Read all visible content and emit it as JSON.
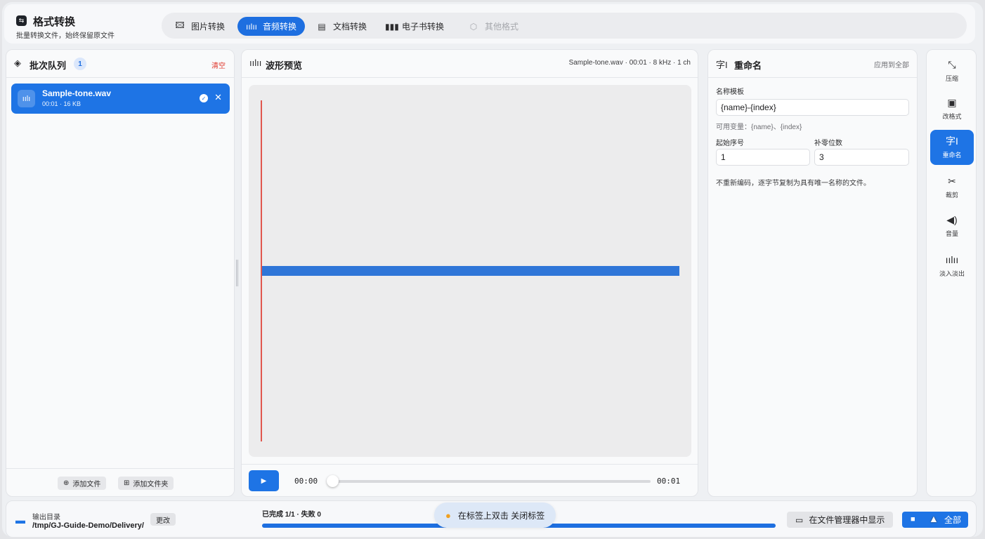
{
  "app": {
    "title": "格式转换",
    "subtitle": "批量转换文件，始终保留原文件",
    "icon": "swap-icon"
  },
  "tabs": [
    {
      "label": "图片转换",
      "icon": "image-icon",
      "active": false
    },
    {
      "label": "音频转换",
      "icon": "waveform-icon",
      "active": true
    },
    {
      "label": "文档转换",
      "icon": "document-icon",
      "active": false
    },
    {
      "label": "电子书转换",
      "icon": "books-icon",
      "active": false
    },
    {
      "label": "其他格式",
      "icon": "cube-icon",
      "active": false,
      "disabled": true
    }
  ],
  "queue": {
    "title": "批次队列",
    "count": "1",
    "clear_label": "清空",
    "files": [
      {
        "name": "Sample-tone.wav",
        "meta": "00:01 · 16 KB"
      }
    ],
    "add_file_label": "添加文件",
    "add_folder_label": "添加文件夹"
  },
  "preview": {
    "title": "波形预览",
    "meta": "Sample-tone.wav · 00:01 · 8 kHz · 1 ch",
    "current_time": "00:00",
    "total_time": "00:01",
    "position": 0
  },
  "rename": {
    "title": "重命名",
    "apply_all_label": "应用到全部",
    "template_label": "名称模板",
    "template_value": "{name}-{index}",
    "variables_hint": "可用变量：{name}、{index}",
    "start_label": "起始序号",
    "start_value": "1",
    "padding_label": "补零位数",
    "padding_value": "3",
    "note": "不重新编码，逐字节复制为具有唯一名称的文件。"
  },
  "tools": [
    {
      "label": "压缩",
      "icon": "compress-icon",
      "active": false
    },
    {
      "label": "改格式",
      "icon": "format-icon",
      "active": false
    },
    {
      "label": "重命名",
      "icon": "rename-icon",
      "active": true
    },
    {
      "label": "裁剪",
      "icon": "scissors-icon",
      "active": false
    },
    {
      "label": "音量",
      "icon": "speaker-icon",
      "active": false
    },
    {
      "label": "淡入淡出",
      "icon": "fade-icon",
      "active": false
    }
  ],
  "bottom": {
    "output_label": "输出目录",
    "output_path": "/tmp/GJ-Guide-Demo/Delivery/",
    "change_label": "更改",
    "progress_text": "已完成 1/1 · 失败 0",
    "progress": 1.0,
    "tooltip": "在标签上双击 关闭标签",
    "show_in_manager_label": "在文件管理器中显示",
    "run_label": "全部"
  },
  "colors": {
    "accent": "#1e74e5",
    "danger": "#e03a2f",
    "playhead": "#e0574e",
    "waveform": "#2f76d8"
  }
}
